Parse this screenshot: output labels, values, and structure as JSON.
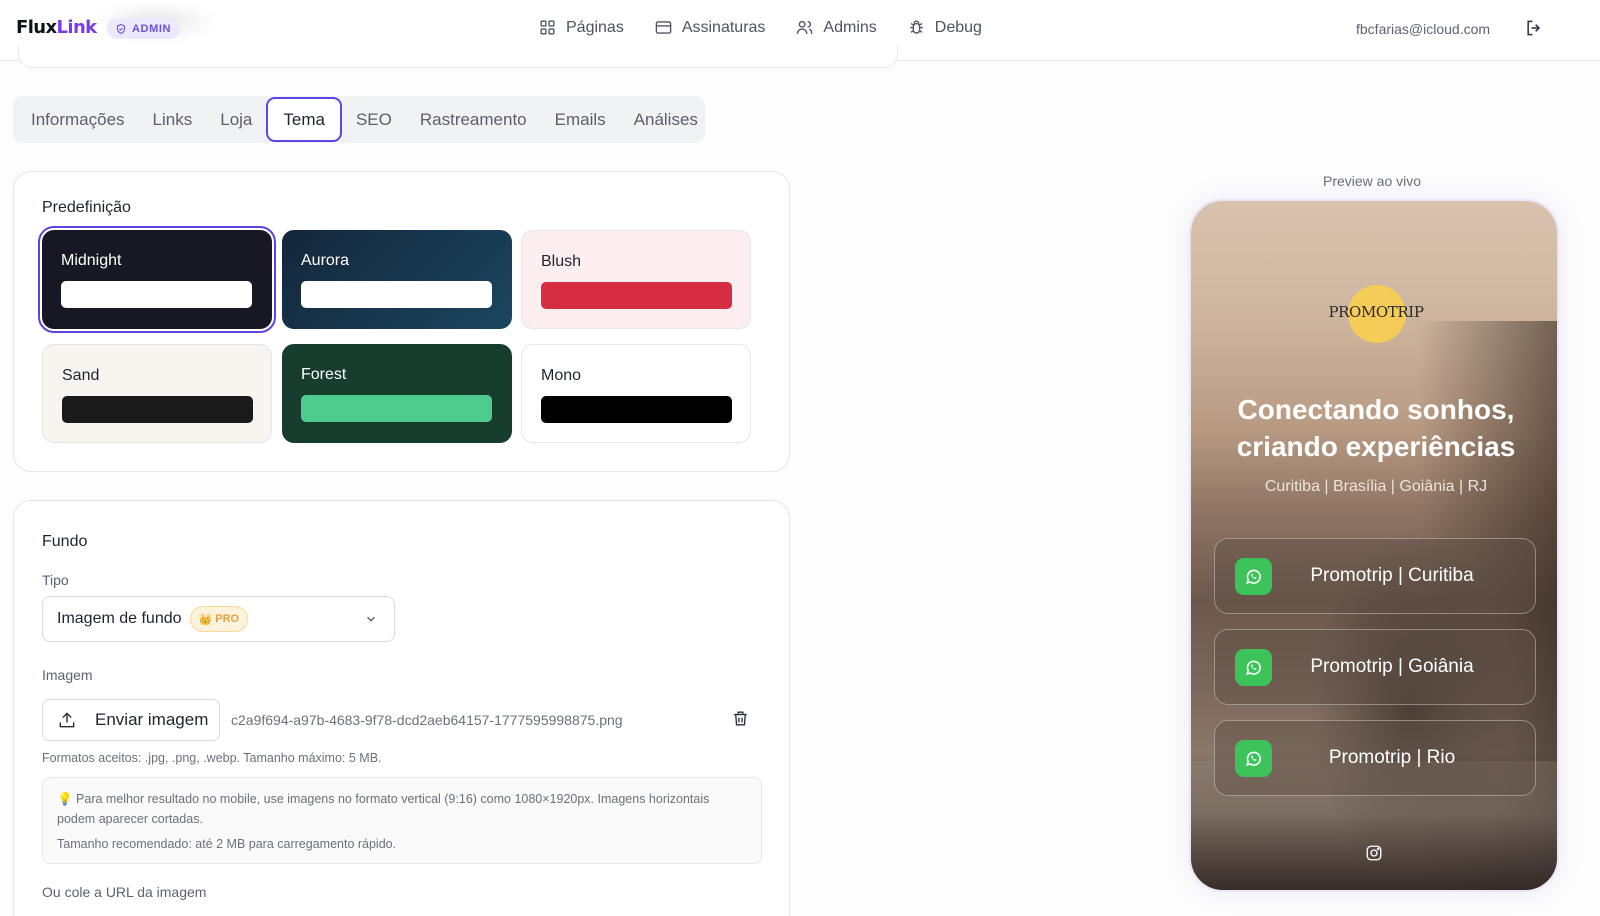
{
  "header": {
    "logo_a": "Flux",
    "logo_b": "Link",
    "admin_badge": "ADMIN",
    "nav": [
      {
        "label": "Páginas",
        "icon": "grid-icon"
      },
      {
        "label": "Assinaturas",
        "icon": "credit-card-icon"
      },
      {
        "label": "Admins",
        "icon": "users-icon"
      },
      {
        "label": "Debug",
        "icon": "bug-icon"
      }
    ],
    "user_email": "fbcfarias@icloud.com",
    "logout_icon": "logout-icon"
  },
  "tabs": [
    {
      "label": "Informações"
    },
    {
      "label": "Links"
    },
    {
      "label": "Loja"
    },
    {
      "label": "Tema",
      "active": true
    },
    {
      "label": "SEO"
    },
    {
      "label": "Rastreamento"
    },
    {
      "label": "Emails"
    },
    {
      "label": "Análises"
    }
  ],
  "presets": {
    "title": "Predefinição",
    "items": [
      {
        "name": "Midnight",
        "bg": "#171824",
        "text": "#ffffff",
        "bar": "#ffffff",
        "selected": true
      },
      {
        "name": "Aurora",
        "bg": "#1b3f57",
        "text": "#ffffff",
        "bar": "#ffffff"
      },
      {
        "name": "Blush",
        "bg": "#fdeef0",
        "text": "#1f2430",
        "bar": "#d62d43"
      },
      {
        "name": "Sand",
        "bg": "#f8f5f0",
        "text": "#1f2430",
        "bar": "#1a1a1a"
      },
      {
        "name": "Forest",
        "bg": "#163d2e",
        "text": "#ffffff",
        "bar": "#4ecb8d"
      },
      {
        "name": "Mono",
        "bg": "#ffffff",
        "text": "#1f2430",
        "bar": "#000000"
      }
    ]
  },
  "fundo": {
    "title": "Fundo",
    "tipo_label": "Tipo",
    "tipo_value": "Imagem de fundo",
    "pro_badge": "PRO",
    "imagem_label": "Imagem",
    "upload_label": "Enviar imagem",
    "filename": "c2a9f694-a97b-4683-9f78-dcd2aeb64157-1777595998875.png",
    "formats_hint": "Formatos aceitos: .jpg, .png, .webp. Tamanho máximo: 5 MB.",
    "tip": "💡 Para melhor resultado no mobile, use imagens no formato vertical (9:16) como 1080×1920px. Imagens horizontais podem aparecer cortadas.",
    "recommended": "Tamanho recomendado: até 2 MB para carregamento rápido.",
    "url_label": "Ou cole a URL da imagem"
  },
  "preview": {
    "label": "Preview ao vivo",
    "brand": "PROMOTRIP",
    "headline_1": "Conectando sonhos,",
    "headline_2": "criando experiências",
    "subtitle": "Curitiba | Brasília | Goiânia | RJ",
    "links": [
      {
        "label": "Promotrip | Curitiba"
      },
      {
        "label": "Promotrip | Goiânia"
      },
      {
        "label": "Promotrip | Rio"
      }
    ],
    "social_icon": "instagram-icon"
  },
  "colors": {
    "accent": "#5b45e0",
    "whatsapp": "#3cc35a",
    "brand_circle": "#f6cc59"
  }
}
